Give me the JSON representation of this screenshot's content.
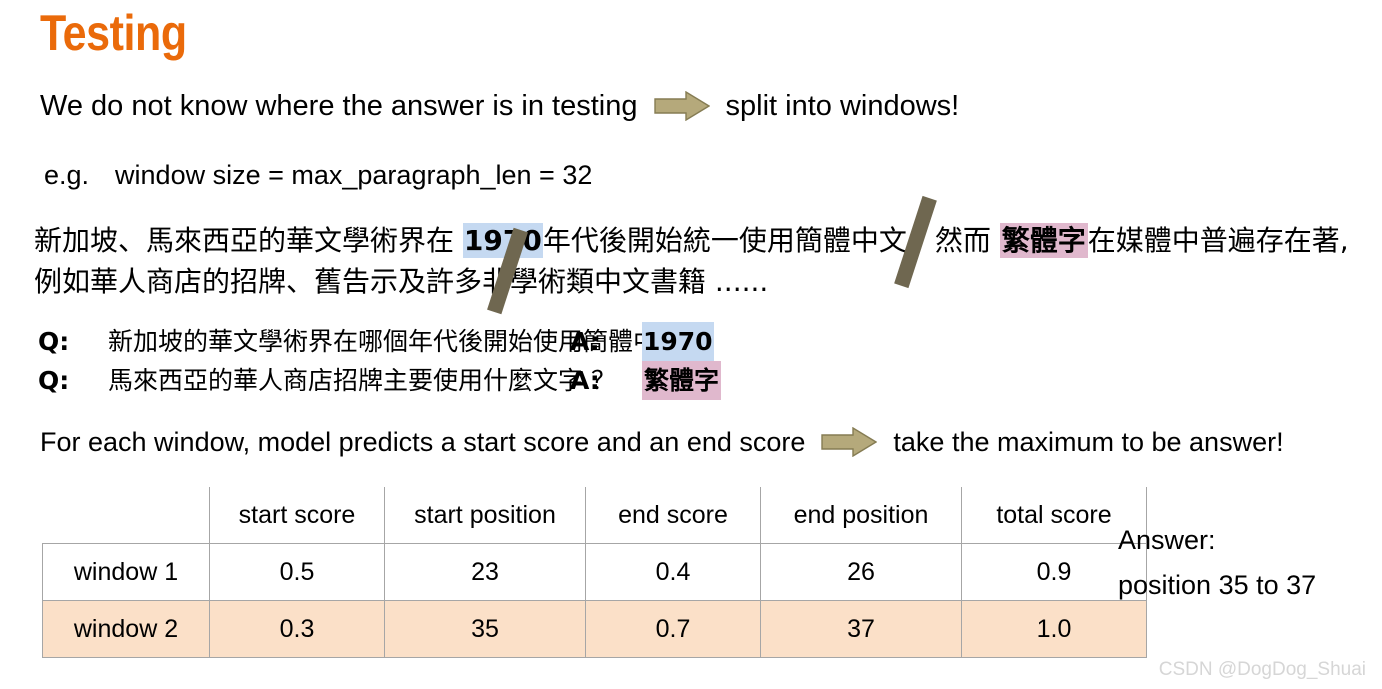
{
  "slide": {
    "title": "Testing",
    "title_color": "#EA6A0A"
  },
  "intro_line": {
    "before_arrow": "We do not know where the answer is in testing",
    "arrow_icon": "right-block-arrow-icon",
    "after_arrow": "split into windows!"
  },
  "example_line": {
    "label": "e.g.",
    "text": "window size = max_paragraph_len = 32"
  },
  "passage": {
    "part1": "新加坡、馬來西亞的華文學術界在 ",
    "highlight1": "1970",
    "part2": "年代後開始統一使用簡體中文；然而 ",
    "highlight2": "繁體字",
    "part3": "在媒體中普遍存在著, 例如華人商店的招牌、舊告示及許多非學術類中文書籍 ......",
    "highlight1_color": "#c5d9f1",
    "highlight2_color": "#e0b8cd",
    "separator_color": "#6f6750"
  },
  "qa": [
    {
      "q_label": "Q:",
      "question": "新加坡的華文學術界在哪個年代後開始使用簡體中文 ？",
      "a_label": "A:",
      "answer": "1970",
      "answer_highlight": "blue"
    },
    {
      "q_label": "Q:",
      "question": "馬來西亞的華人商店招牌主要使用什麼文字 ？",
      "a_label": "A:",
      "answer": "繁體字",
      "answer_highlight": "pink"
    }
  ],
  "foreach_line": {
    "before_arrow": "For each window, model predicts a start score and an end score",
    "arrow_icon": "right-block-arrow-icon",
    "after_arrow": "take the maximum to be answer!"
  },
  "table": {
    "columns": [
      "",
      "start score",
      "start position",
      "end score",
      "end position",
      "total score"
    ],
    "rows": [
      {
        "label": "window 1",
        "cells": [
          "0.5",
          "23",
          "0.4",
          "26",
          "0.9"
        ],
        "highlighted": false
      },
      {
        "label": "window 2",
        "cells": [
          "0.3",
          "35",
          "0.7",
          "37",
          "1.0"
        ],
        "highlighted": true
      }
    ],
    "highlight_color": "#fbe0c8",
    "border_color": "#a6a6a6"
  },
  "answer_note": {
    "line1": "Answer:",
    "line2": "position 35 to 37"
  },
  "watermark": {
    "text": "CSDN @DogDog_Shuai"
  }
}
